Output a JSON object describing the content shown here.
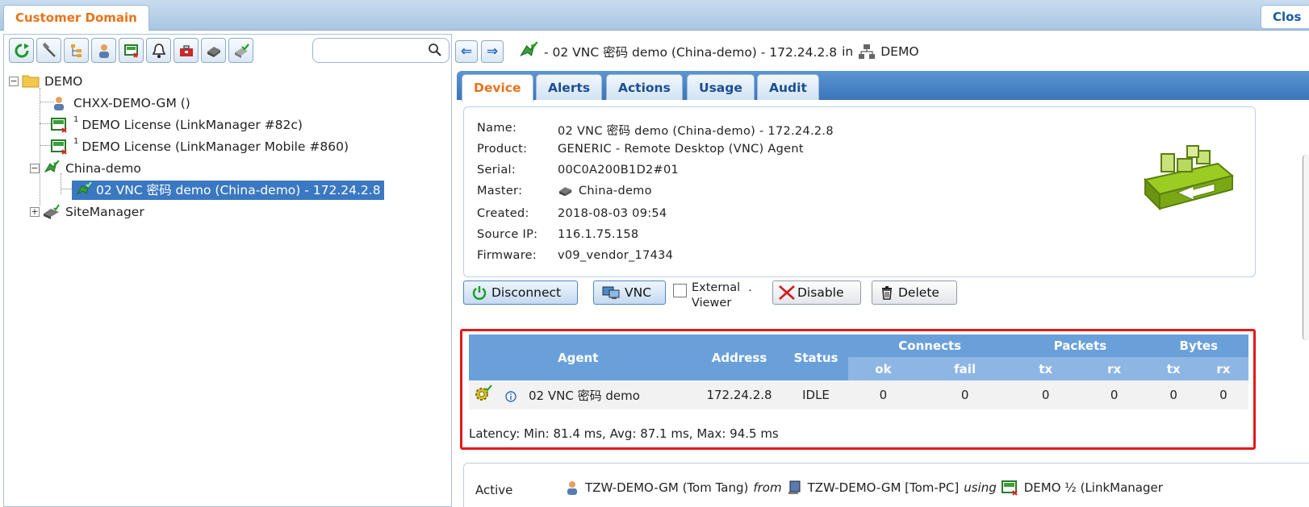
{
  "window": {
    "domain_tab": "Customer Domain",
    "close_tab": "Clos"
  },
  "left": {
    "search_placeholder": "",
    "toolbar_icons": [
      "refresh-icon",
      "hammer-icon",
      "tree-icon",
      "user-icon",
      "license-icon",
      "bell-icon",
      "toolbox-icon",
      "gateway-icon",
      "gateway-check-icon"
    ],
    "tree": {
      "root": "DEMO",
      "user": "CHXX-DEMO-GM ()",
      "license1": "DEMO License (LinkManager #82c)",
      "license1_sup": "1",
      "license2": "DEMO License (LinkManager Mobile #860)",
      "license2_sup": "1",
      "china": "China-demo",
      "vnc": "02 VNC 密码 demo (China-demo) - 172.24.2.8",
      "site": "SiteManager"
    }
  },
  "right": {
    "breadcrumb": {
      "device": "- 02 VNC 密码 demo (China-demo) - 172.24.2.8",
      "in": "in",
      "domain": "DEMO"
    },
    "tabs": [
      "Device",
      "Alerts",
      "Actions",
      "Usage",
      "Audit"
    ],
    "info": {
      "name_label": "Name:",
      "name": "02 VNC 密码 demo (China-demo) - 172.24.2.8",
      "product_label": "Product:",
      "product": "GENERIC - Remote Desktop (VNC) Agent",
      "serial_label": "Serial:",
      "serial": "00C0A200B1D2#01",
      "master_label": "Master:",
      "master": "China-demo",
      "created_label": "Created:",
      "created": "2018-08-03 09:54",
      "source_ip_label": "Source IP:",
      "source_ip": "116.1.75.158",
      "firmware_label": "Firmware:",
      "firmware": "v09_vendor_17434"
    },
    "buttons": {
      "disconnect": "Disconnect",
      "vnc": "VNC",
      "external_viewer_line1": "External",
      "external_viewer_line2": "Viewer",
      "dot": ".",
      "disable": "Disable",
      "delete": "Delete"
    },
    "agent_table": {
      "headers": {
        "agent": "Agent",
        "address": "Address",
        "status": "Status",
        "connects": "Connects",
        "packets": "Packets",
        "bytes": "Bytes",
        "ok": "ok",
        "fail": "fail",
        "tx": "tx",
        "rx": "rx"
      },
      "row": {
        "agent": "02 VNC 密码 demo",
        "address": "172.24.2.8",
        "status": "IDLE",
        "connects_ok": "0",
        "connects_fail": "0",
        "packets_tx": "0",
        "packets_rx": "0",
        "bytes_tx": "0",
        "bytes_rx": "0"
      },
      "latency": "Latency: Min: 81.4 ms, Avg: 87.1 ms, Max: 94.5 ms"
    },
    "active": {
      "label": "Active",
      "user": "TZW-DEMO-GM (Tom Tang)",
      "from": "from",
      "pc": "TZW-DEMO-GM [Tom-PC]",
      "using": "using",
      "license": "DEMO ½ (LinkManager"
    }
  }
}
